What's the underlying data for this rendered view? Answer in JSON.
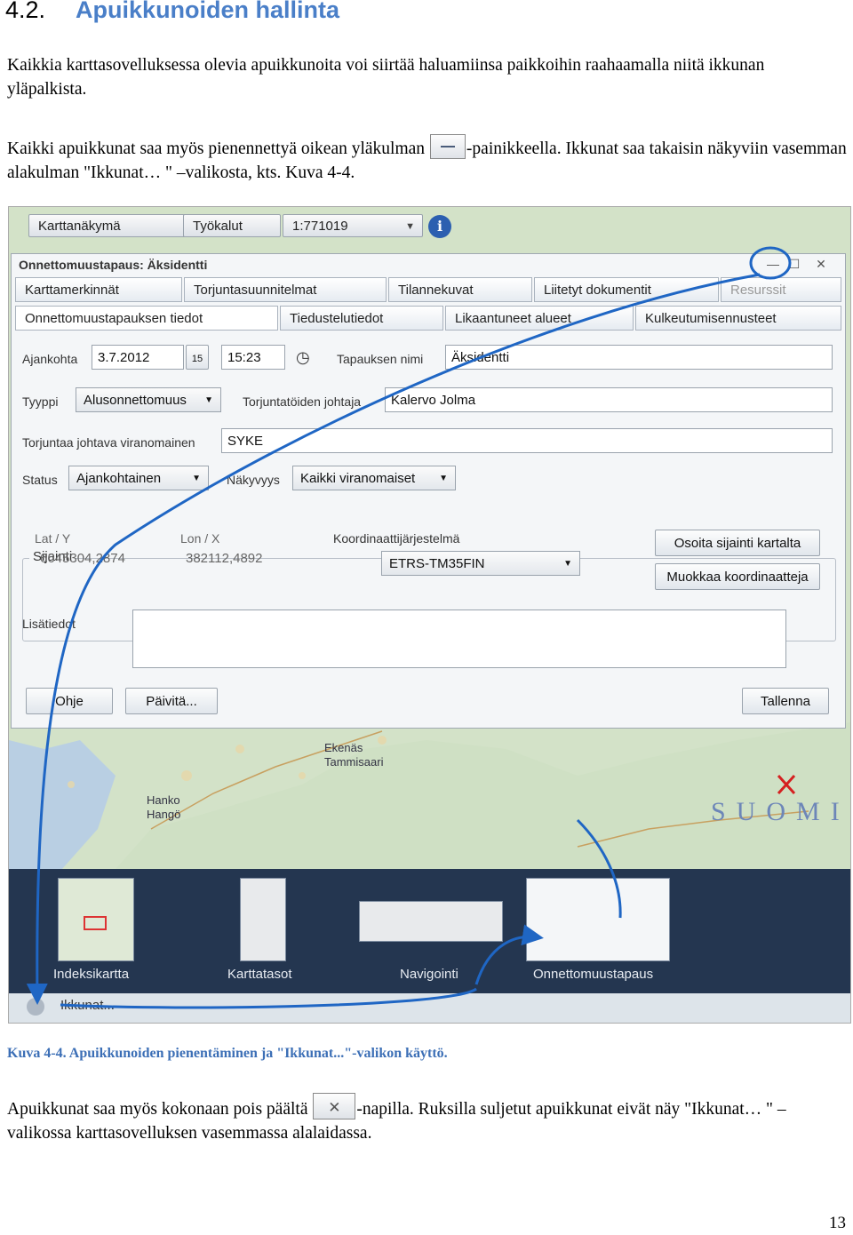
{
  "heading": {
    "number": "4.2.",
    "title": "Apuikkunoiden hallinta"
  },
  "paragraphs": {
    "p1": "Kaikkia karttasovelluksessa olevia apuikkunoita voi siirtää haluamiinsa paikkoihin raahaamalla niitä ikkunan yläpalkista.",
    "p2_before": "Kaikki apuikkunat saa myös pienennettyä oikean yläkulman",
    "p2_after": "-painikkeella. Ikkunat saa takaisin näkyviin vasemman alakulman \"Ikkunat… \" –valikosta, kts. Kuva 4-4.",
    "p3_before": "Apuikkunat saa myös kokonaan pois päältä",
    "p3_after": "-napilla. Ruksilla suljetut apuikkunat eivät näy \"Ikkunat… \" –valikossa karttasovelluksen vasemmassa alalaidassa."
  },
  "toolbar": {
    "map_view": "Karttanäkymä",
    "tools": "Työkalut",
    "scale": "1:771019"
  },
  "window": {
    "title": "Onnettomuustapaus: Äksidentti",
    "tabs_row1": [
      "Karttamerkinnät",
      "Torjuntasuunnitelmat",
      "Tilannekuvat",
      "Liitetyt dokumentit",
      "Resurssit"
    ],
    "tabs_row2": [
      "Onnettomuustapauksen tiedot",
      "Tiedustelutiedot",
      "Likaantuneet alueet",
      "Kulkeutumisennusteet"
    ],
    "labels": {
      "date": "Ajankohta",
      "name": "Tapauksen nimi",
      "type": "Tyyppi",
      "leader": "Torjuntatöiden johtaja",
      "authority": "Torjuntaa johtava viranomainen",
      "status": "Status",
      "visibility": "Näkyvyys",
      "location": "Sijainti",
      "lat": "Lat / Y",
      "lon": "Lon / X",
      "crs": "Koordinaattijärjestelmä",
      "notes": "Lisätiedot"
    },
    "values": {
      "date": "3.7.2012",
      "time": "15:23",
      "name": "Äksidentti",
      "type": "Alusonnettomuus",
      "leader": "Kalervo Jolma",
      "authority": "SYKE",
      "status": "Ajankohtainen",
      "visibility": "Kaikki viranomaiset",
      "lat": "6645304,2874",
      "lon": "382112,4892",
      "crs": "ETRS-TM35FIN"
    },
    "buttons": {
      "show_on_map": "Osoita sijainti kartalta",
      "edit_coords": "Muokkaa koordinaatteja",
      "help": "Ohje",
      "refresh": "Päivitä...",
      "save": "Tallenna"
    }
  },
  "map_labels": [
    "Hanko",
    "Hangö",
    "Ekenäs",
    "Tammisaari",
    "SUOMI"
  ],
  "taskbar": [
    "Indeksikartta",
    "Karttatasot",
    "Navigointi",
    "Onnettomuustapaus"
  ],
  "ikkunat": "Ikkunat...",
  "caption": "Kuva 4-4. Apuikkunoiden  pienentäminen ja \"Ikkunat...\"-valikon käyttö.",
  "page_number": "13",
  "colors": {
    "heading": "#4a7fc8",
    "caption": "#3c6fb6",
    "arrow": "#1f66c4",
    "taskbar": "#243650"
  }
}
